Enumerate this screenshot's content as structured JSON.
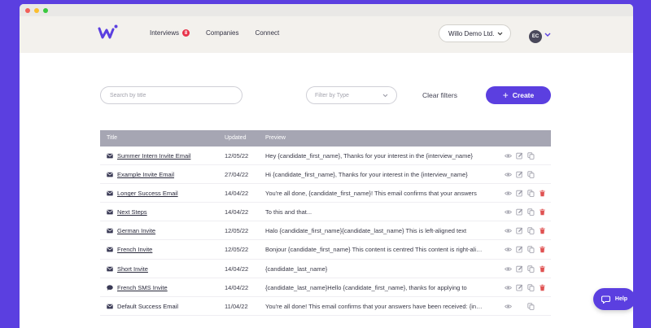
{
  "colors": {
    "accent": "#5b3fe0",
    "badge": "#e8334a",
    "delete": "#e05252",
    "header_bg": "#f3f1ed",
    "table_header": "#a6a6b3",
    "window_dots": [
      "#f25f58",
      "#fbbe2e",
      "#3ac93f"
    ]
  },
  "nav": {
    "interviews": "Interviews",
    "interviews_badge": "8",
    "companies": "Companies",
    "connect": "Connect"
  },
  "company_select": {
    "value": "Willo Demo Ltd."
  },
  "user": {
    "initials": "EC"
  },
  "filters": {
    "search_placeholder": "Search by title",
    "type_placeholder": "Filter by Type",
    "clear_label": "Clear filters",
    "create_label": "Create"
  },
  "table": {
    "headers": {
      "title": "Title",
      "updated": "Updated",
      "preview": "Preview"
    },
    "rows": [
      {
        "icon": "mail-icon",
        "title": "Summer Intern Invite Email",
        "updated": "12/05/22",
        "preview": "Hey {candidate_first_name},   Thanks for your interest in the {interview_name}",
        "deletable": false
      },
      {
        "icon": "mail-icon",
        "title": "Example Invite Email",
        "updated": "27/04/22",
        "preview": "Hi {candidate_first_name},   Thanks for your interest in the {interview_name}",
        "deletable": false
      },
      {
        "icon": "mail-icon",
        "title": "Longer Success Email",
        "updated": "14/04/22",
        "preview": "You're all done, {candidate_first_name}!   This email confirms that your answers",
        "deletable": true
      },
      {
        "icon": "mail-icon",
        "title": "Next Steps",
        "updated": "14/04/22",
        "preview": "To this and that...",
        "deletable": true
      },
      {
        "icon": "mail-icon",
        "title": "German Invite",
        "updated": "12/05/22",
        "preview": "Halo {candidate_first_name}{candidate_last_name} This is left-aligned text",
        "deletable": true
      },
      {
        "icon": "mail-icon",
        "title": "French Invite",
        "updated": "12/05/22",
        "preview": "Bonjour {candidate_first_name} This content is centred This content is right-aligned",
        "deletable": true
      },
      {
        "icon": "mail-icon",
        "title": "Short Invite",
        "updated": "14/04/22",
        "preview": "{candidate_last_name}",
        "deletable": true
      },
      {
        "icon": "sms-icon",
        "title": "French SMS Invite",
        "updated": "14/04/22",
        "preview": "{candidate_last_name}Hello {candidate_first_name}, thanks for applying to",
        "deletable": true
      },
      {
        "icon": "mail-icon",
        "title": "Default Success Email",
        "updated": "11/04/22",
        "preview": "You're all done! This email confirms that your answers have been received: {interview_name}",
        "deletable": false,
        "editable": false,
        "underline": false
      }
    ]
  },
  "help": {
    "label": "Help"
  }
}
